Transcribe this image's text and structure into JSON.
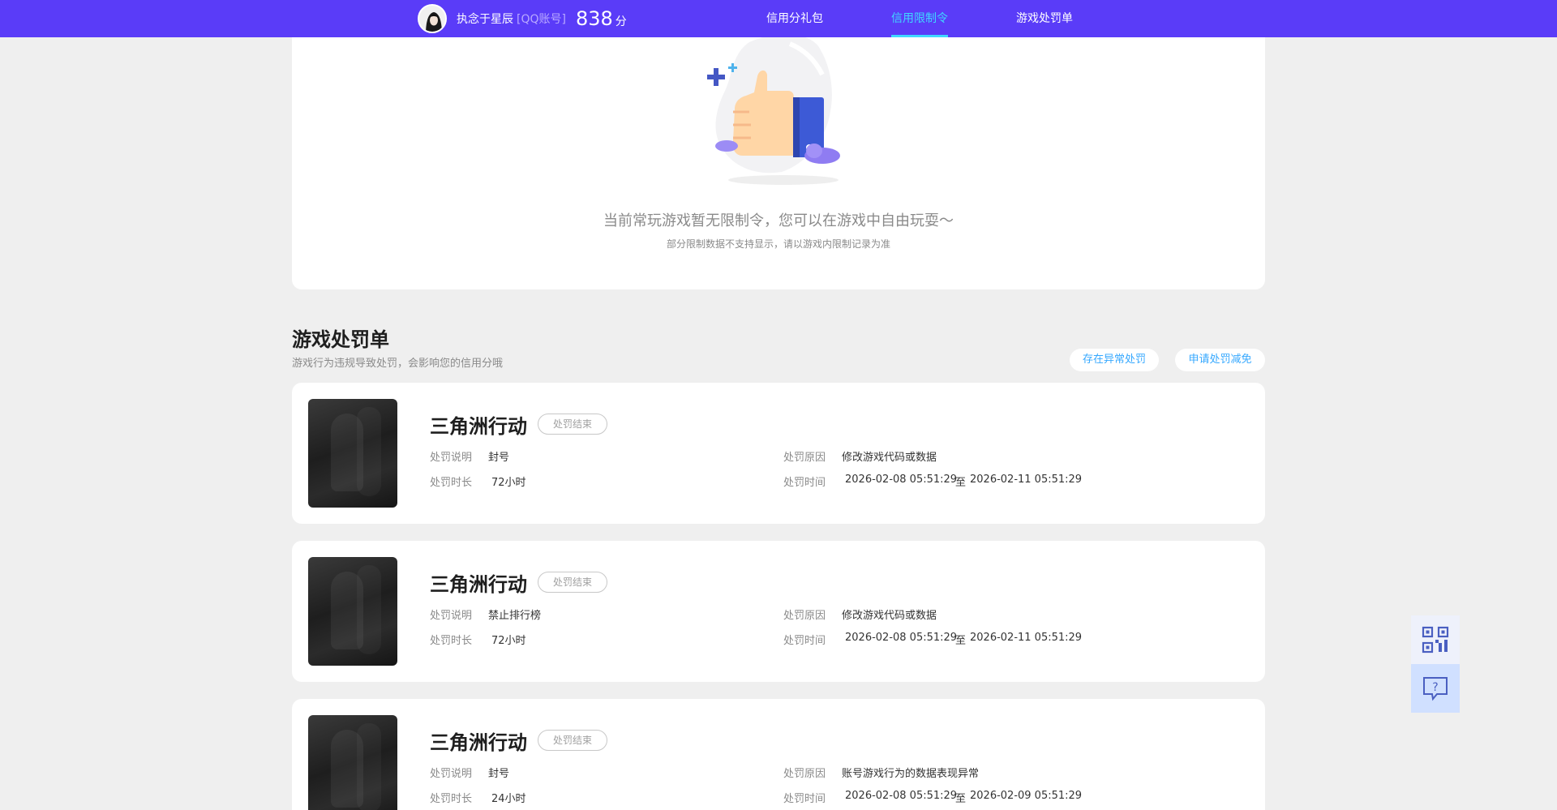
{
  "header": {
    "user_name": "执念于星辰",
    "account_type": "[QQ账号]",
    "score": "838",
    "score_unit": "分",
    "nav": [
      {
        "label": "信用分礼包",
        "active": false
      },
      {
        "label": "信用限制令",
        "active": true
      },
      {
        "label": "游戏处罚单",
        "active": false
      }
    ]
  },
  "restriction": {
    "empty_message": "当前常玩游戏暂无限制令，您可以在游戏中自由玩耍～",
    "note": "部分限制数据不支持显示，请以游戏内限制记录为准"
  },
  "penalty_section": {
    "title": "游戏处罚单",
    "description": "游戏行为违规导致处罚，会影响您的信用分哦",
    "button_abnormal": "存在异常处罚",
    "button_appeal": "申请处罚减免",
    "labels": {
      "description": "处罚说明",
      "duration": "处罚时长",
      "reason": "处罚原因",
      "time": "处罚时间"
    },
    "items": [
      {
        "game": "三角洲行动",
        "status": "处罚结束",
        "description": "封号",
        "duration": "72小时",
        "reason": "修改游戏代码或数据",
        "start": "2026-02-08 05:51:29",
        "to": "至",
        "end": "2026-02-11 05:51:29"
      },
      {
        "game": "三角洲行动",
        "status": "处罚结束",
        "description": "禁止排行榜",
        "duration": "72小时",
        "reason": "修改游戏代码或数据",
        "start": "2026-02-08 05:51:29",
        "to": "至",
        "end": "2026-02-11 05:51:29"
      },
      {
        "game": "三角洲行动",
        "status": "处罚结束",
        "description": "封号",
        "duration": "24小时",
        "reason": "账号游戏行为的数据表现异常",
        "start": "2026-02-08 05:51:29",
        "to": "至",
        "end": "2026-02-09 05:51:29"
      }
    ]
  },
  "icons": {
    "avatar": "user-avatar",
    "qr": "qrcode-icon",
    "help": "help-chat-icon",
    "illustration": "thumbs-up-illustration"
  },
  "colors": {
    "topbar": "#5a3cf8",
    "active_nav": "#3fd8ff",
    "link": "#35a8ff"
  }
}
